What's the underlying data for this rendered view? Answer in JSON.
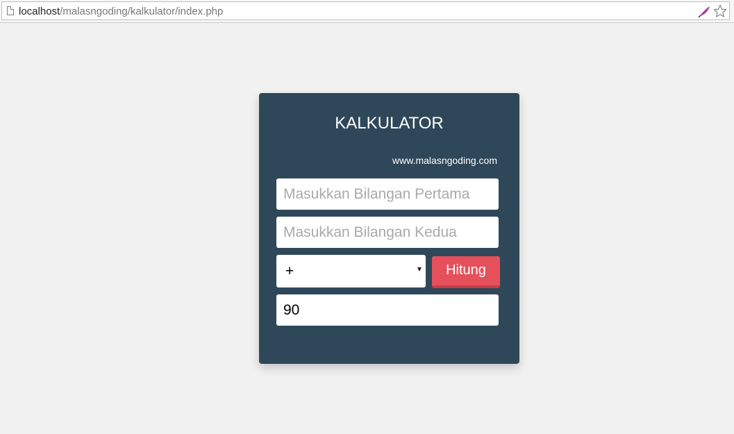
{
  "browser": {
    "url_host": "localhost",
    "url_path": "/malasngoding/kalkulator/index.php",
    "icons": [
      "page-icon",
      "feather-extension-icon",
      "star-bookmark-icon"
    ]
  },
  "calculator": {
    "title": "KALKULATOR",
    "site_link": "www.malasngoding.com",
    "first_input_placeholder": "Masukkan Bilangan Pertama",
    "second_input_placeholder": "Masukkan Bilangan Kedua",
    "operator_selected": "+",
    "submit_label": "Hitung",
    "result_value": "90"
  },
  "colors": {
    "page_background": "#f1f1f1",
    "card_background": "#2f4859",
    "button_background": "#e5505a",
    "button_shadow": "#c63c46"
  }
}
